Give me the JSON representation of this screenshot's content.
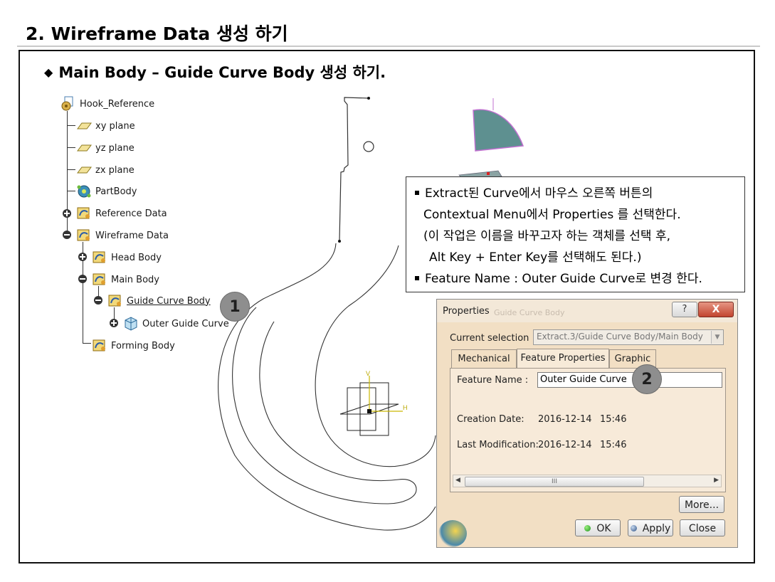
{
  "slide": {
    "title": "2. Wireframe Data 생성 하기",
    "subtitle": "Main Body – Guide Curve Body 생성 하기."
  },
  "tree": {
    "items": [
      {
        "label": "Hook_Reference",
        "icon": "product-icon"
      },
      {
        "label": "xy plane",
        "icon": "plane-icon"
      },
      {
        "label": "yz plane",
        "icon": "plane-icon"
      },
      {
        "label": "zx plane",
        "icon": "plane-icon"
      },
      {
        "label": "PartBody",
        "icon": "gear-body-icon"
      },
      {
        "label": "Reference Data",
        "icon": "geometrical-set-icon"
      },
      {
        "label": "Wireframe Data",
        "icon": "geometrical-set-icon"
      },
      {
        "label": "Head Body",
        "icon": "geometrical-set-icon"
      },
      {
        "label": "Main Body",
        "icon": "geometrical-set-icon"
      },
      {
        "label": "Guide Curve Body",
        "icon": "geometrical-set-icon"
      },
      {
        "label": "Outer Guide Curve",
        "icon": "extract-icon"
      },
      {
        "label": "Forming Body",
        "icon": "geometrical-set-icon"
      }
    ]
  },
  "badges": {
    "one": "1",
    "two": "2"
  },
  "callout": {
    "line1": "Extract된 Curve에서 마우스 오른쪽 버튼의",
    "line2": "Contextual Menu에서 Properties 를 선택한다.",
    "line3": "(이 작업은 이름을 바꾸고자 하는 객체를 선택 후,",
    "line4": "Alt Key + Enter Key를 선택해도 된다.)",
    "line5": "Feature Name : Outer Guide Curve로 변경 한다."
  },
  "axis_labels": {
    "v": "V",
    "h": "H"
  },
  "dialog": {
    "title": "Properties",
    "ghost_title": "Guide Curve Body",
    "help_label": "?",
    "close_label": "X",
    "current_selection_label": "Current selection :",
    "current_selection_value": "Extract.3/Guide Curve Body/Main Body",
    "tabs": [
      "Mechanical",
      "Feature Properties",
      "Graphic"
    ],
    "active_tab": "Feature Properties",
    "feature_name_label": "Feature Name :",
    "feature_name_value": "Outer Guide Curve",
    "creation_date_label": "Creation Date:",
    "creation_date": "2016-12-14",
    "creation_time": "15:46",
    "last_mod_label": "Last Modification:",
    "last_mod_date": "2016-12-14",
    "last_mod_time": "15:46",
    "scroll_thumb": "III",
    "more_label": "More...",
    "ok_label": "OK",
    "apply_label": "Apply",
    "close_button_label": "Close"
  },
  "colors": {
    "accent_teal": "#5e9090",
    "dialog_bg": "#f2dfc4",
    "close_red": "#c2452f",
    "badge_gray": "#8e8e8e"
  }
}
